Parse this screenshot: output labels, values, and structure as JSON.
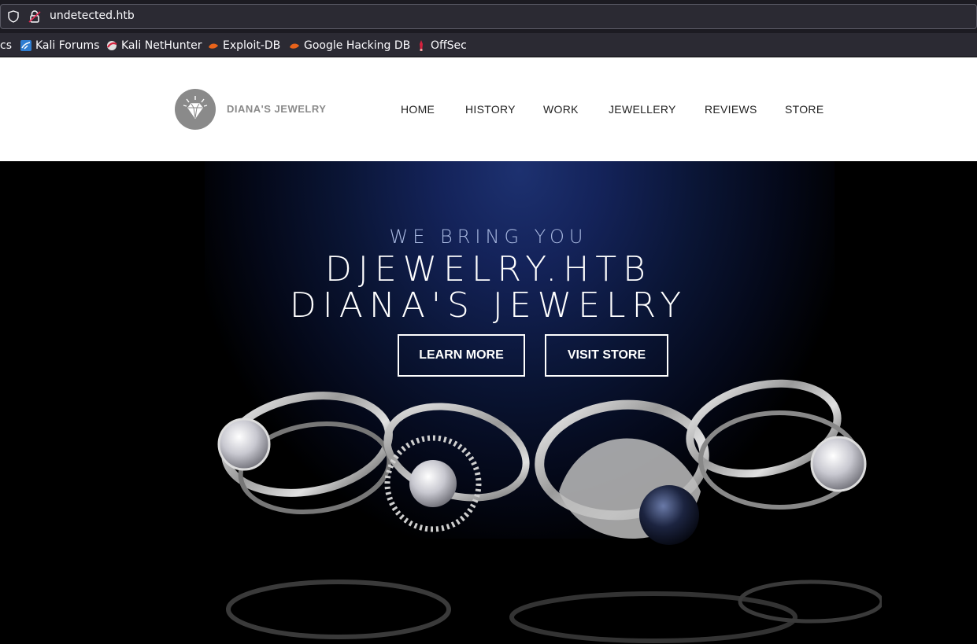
{
  "browser": {
    "url": "undetected.htb",
    "bookmarks": [
      {
        "label": "cs",
        "icon": "partial-bookmark"
      },
      {
        "label": "Kali Forums",
        "icon": "kali-icon"
      },
      {
        "label": "Kali NetHunter",
        "icon": "nethunter-icon"
      },
      {
        "label": "Exploit-DB",
        "icon": "exploitdb-icon"
      },
      {
        "label": "Google Hacking DB",
        "icon": "ghdb-icon"
      },
      {
        "label": "OffSec",
        "icon": "offsec-icon"
      }
    ]
  },
  "site": {
    "logo_text": "DIANA'S JEWELRY",
    "nav": [
      "HOME",
      "HISTORY",
      "WORK",
      "JEWELLERY",
      "REVIEWS",
      "STORE"
    ]
  },
  "hero": {
    "tagline": "WE BRING YOU",
    "title_line1": "DJEWELRY.HTB",
    "title_line2": "DIANA'S JEWELRY",
    "learn_more": "LEARN MORE",
    "visit_store": "VISIT STORE"
  },
  "colors": {
    "hero_glow": "#1d3170",
    "logo_gray": "#8a8a8a"
  }
}
